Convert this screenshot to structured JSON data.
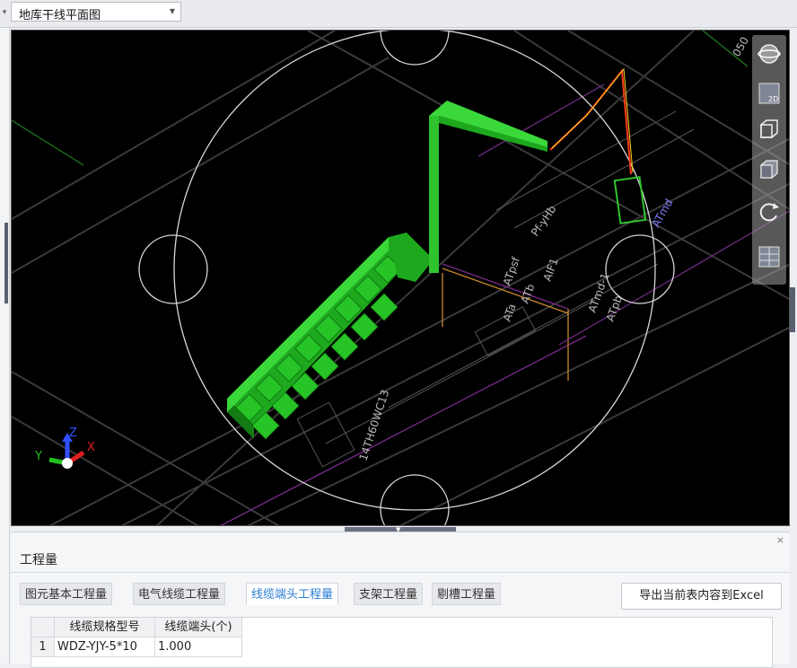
{
  "toolbar": {
    "layer_select_value": "地库干线平面图"
  },
  "viewport": {
    "axis_labels": {
      "x": "X",
      "y": "Y",
      "z": "Z"
    },
    "view_buttons": [
      "orbit-icon",
      "2d-view-icon",
      "3d-box-icon",
      "shaded-box-icon",
      "rotate-icon",
      "grid-layout-icon"
    ],
    "view_2d_label": "2D",
    "drawing_text": [
      "Pf-yHb",
      "ATpsf",
      "AIF1",
      "ATb",
      "ATa",
      "ATmd",
      "14TH60WC13",
      "ATmd-1",
      "ATpb",
      "050"
    ],
    "colors": {
      "tray": "#2fc42f",
      "cable_red": "#ff3a1a",
      "cable_yellow": "#ffd21a",
      "background": "#000000"
    }
  },
  "panel": {
    "title": "工程量",
    "close": "×",
    "tabs": [
      "图元基本工程量",
      "电气线缆工程量",
      "线缆端头工程量",
      "支架工程量",
      "剔槽工程量"
    ],
    "active_tab": 2,
    "export_button": "导出当前表内容到Excel",
    "table": {
      "headers": [
        "线缆规格型号",
        "线缆端头(个)"
      ],
      "rows": [
        {
          "num": "1",
          "spec": "WDZ-YJY-5*10",
          "count": "1.000"
        }
      ]
    }
  }
}
